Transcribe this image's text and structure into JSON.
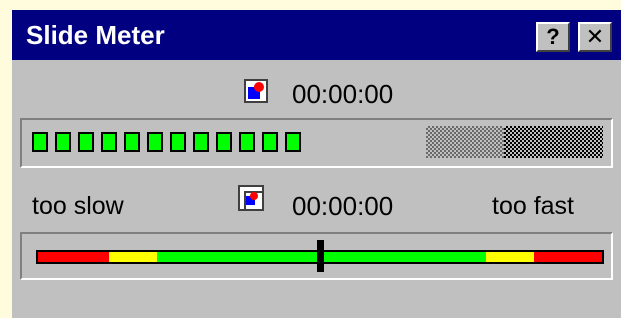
{
  "window": {
    "title": "Slide Meter",
    "help_label": "?",
    "close_label": "✕"
  },
  "presentation": {
    "icon": "slide-icon",
    "elapsed": "00:00:00"
  },
  "slide_progress": {
    "icon": "slides-stack-icon",
    "elapsed": "00:00:00"
  },
  "pace": {
    "slow_label": "too slow",
    "fast_label": "too fast",
    "level": 0.5,
    "colors": {
      "red": "#FF0000",
      "yellow": "#FFFF00",
      "green": "#00FF00"
    }
  },
  "progress_leds": {
    "lit_count": 12,
    "color": "#00FF00"
  },
  "colors": {
    "titlebar": "#000080",
    "window": "#C0C0C0",
    "background": "#FFFBDD"
  }
}
